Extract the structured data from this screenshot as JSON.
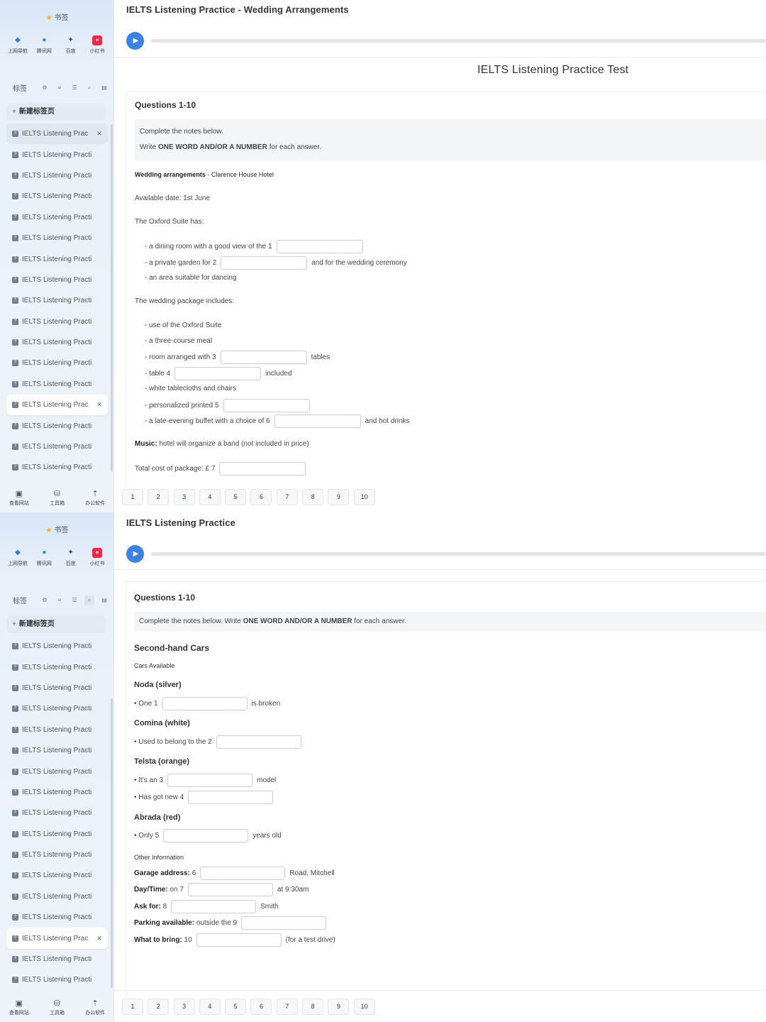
{
  "sidebar": {
    "bookmarks_title": "书签",
    "quick_links": [
      {
        "label": "上网导航",
        "icon": "navigation-icon"
      },
      {
        "label": "腾讯网",
        "icon": "tencent-icon"
      },
      {
        "label": "百度",
        "icon": "baidu-icon"
      },
      {
        "label": "小红书",
        "icon": "xiaohongshu-icon"
      }
    ],
    "tabs_label": "标签",
    "new_tab": "新建标签页",
    "tab_title": "IELTS Listening Practi",
    "tab_title_truncated": "IELTS Listening Prac",
    "bottom": [
      "查看网站",
      "工具箱",
      "办公软件"
    ]
  },
  "shot1": {
    "page_title": "IELTS Listening Practice - Wedding Arrangements",
    "test_title": "IELTS Listening Practice Test",
    "questions": "Questions 1-10",
    "instr1": "Complete the notes below.",
    "instr2_pre": "Write ",
    "instr2_bold": "ONE WORD AND/OR A NUMBER",
    "instr2_post": " for each answer.",
    "heading_bold": "Wedding arrangements",
    "heading_rest": " - Clarence House Hotel",
    "available": "Available date: 1st June",
    "oxford_has": "The Oxford Suite has:",
    "l1": "- a dining room with a good view of the",
    "l2": "- a private garden for",
    "l2_after": "and for the wedding ceremony",
    "l3": "- an area suitable for dancing",
    "pkg": "The wedding package includes:",
    "p1": "- use of the Oxford Suite",
    "p2": "- a three-course meal",
    "p3": "- room arranged with",
    "p3_after": "tables",
    "p4": "- table",
    "p4_after": "included",
    "p5": "- white tablecloths and chairs",
    "p6": "- personalized printed",
    "p7": "- a late-evening buffet with a choice of",
    "p7_after": "and hot drinks",
    "music_label": "Music:",
    "music_text": " hotel will organize a band (not included in price)",
    "total": "Total cost of package: £",
    "nums": [
      "1",
      "2",
      "3",
      "4",
      "5",
      "6",
      "7"
    ]
  },
  "shot2": {
    "page_title": "IELTS Listening Practice",
    "questions": "Questions 1-10",
    "instr_pre": "Complete the notes below. Write ",
    "instr_bold": "ONE WORD AND/OR A NUMBER",
    "instr_post": " for each answer.",
    "title": "Second-hand Cars",
    "cars_available": "Cars Available",
    "noda": "Noda (silver)",
    "noda_line": "• One",
    "noda_after": "is broken",
    "comina": "Comina (white)",
    "comina_line": "• Used to belong to the",
    "telsta": "Telsta (orange)",
    "telsta_line1": "• It's an",
    "telsta_after": "model",
    "telsta_line2": "• Has got new",
    "abrada": "Abrada (red)",
    "abrada_line": "• Only",
    "abrada_after": "years old",
    "other": "Other Information",
    "garage": "Garage address:",
    "garage_after": "Road, Mitchell",
    "day": "Day/Time:",
    "day_on": " on",
    "day_after": "at 9:30am",
    "ask": "Ask for:",
    "ask_after": "Smith",
    "parking": "Parking available:",
    "parking_rest": " outside the",
    "bring": "What to bring:",
    "bring_after": "(for a test drive)",
    "nums": [
      "1",
      "2",
      "3",
      "4",
      "5",
      "6",
      "7",
      "8",
      "9",
      "10"
    ]
  },
  "question_nav": [
    "1",
    "2",
    "3",
    "4",
    "5",
    "6",
    "7",
    "8",
    "9",
    "10"
  ]
}
